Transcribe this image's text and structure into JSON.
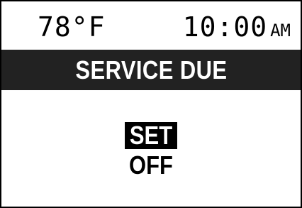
{
  "status": {
    "temperature": "78°F",
    "time": "10:00",
    "ampm": "AM"
  },
  "header": {
    "title": "SERVICE DUE"
  },
  "menu": {
    "items": [
      {
        "label": "SET",
        "selected": true
      },
      {
        "label": "OFF",
        "selected": false
      }
    ]
  },
  "colors": {
    "background": "#ffffff",
    "title_bar": "#222222",
    "text": "#000000",
    "highlight": "#000000"
  }
}
